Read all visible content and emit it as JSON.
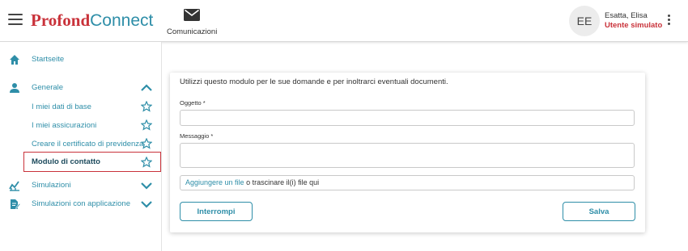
{
  "header": {
    "logo_part1": "Profond",
    "logo_part2": "Connect",
    "communications_label": "Comunicazioni",
    "avatar_initials": "EE",
    "user_name": "Esatta, Elisa",
    "user_role": "Utente simulato"
  },
  "sidebar": {
    "home": "Startseite",
    "general": "Generale",
    "sub_items": [
      "I miei dati di base",
      "I miei assicurazioni",
      "Creare il certificato di previdenza",
      "Modulo di contatto"
    ],
    "simulations": "Simulazioni",
    "simulations_with_application": "Simulazioni con applicazione"
  },
  "form": {
    "intro": "Utilizzi questo modulo per le sue domande e per inoltrarci eventuali documenti.",
    "subject_label": "Oggetto *",
    "subject_value": "",
    "message_label": "Messaggio *",
    "message_value": "",
    "file_link": "Aggiungere un file",
    "file_rest": " o trascinare il(i) file qui",
    "cancel_label": "Interrompi",
    "save_label": "Salva"
  },
  "colors": {
    "brand_red": "#c9323a",
    "brand_teal": "#2e8ea8",
    "active_text": "#1c4a5c"
  },
  "icons": {
    "menu": "hamburger-icon",
    "communications": "mail-icon",
    "more": "kebab-icon",
    "home": "home-icon",
    "general": "person-icon",
    "favorite": "star-outline-icon",
    "simulations": "chart-icon",
    "simulations_with_application": "document-edit-icon"
  }
}
